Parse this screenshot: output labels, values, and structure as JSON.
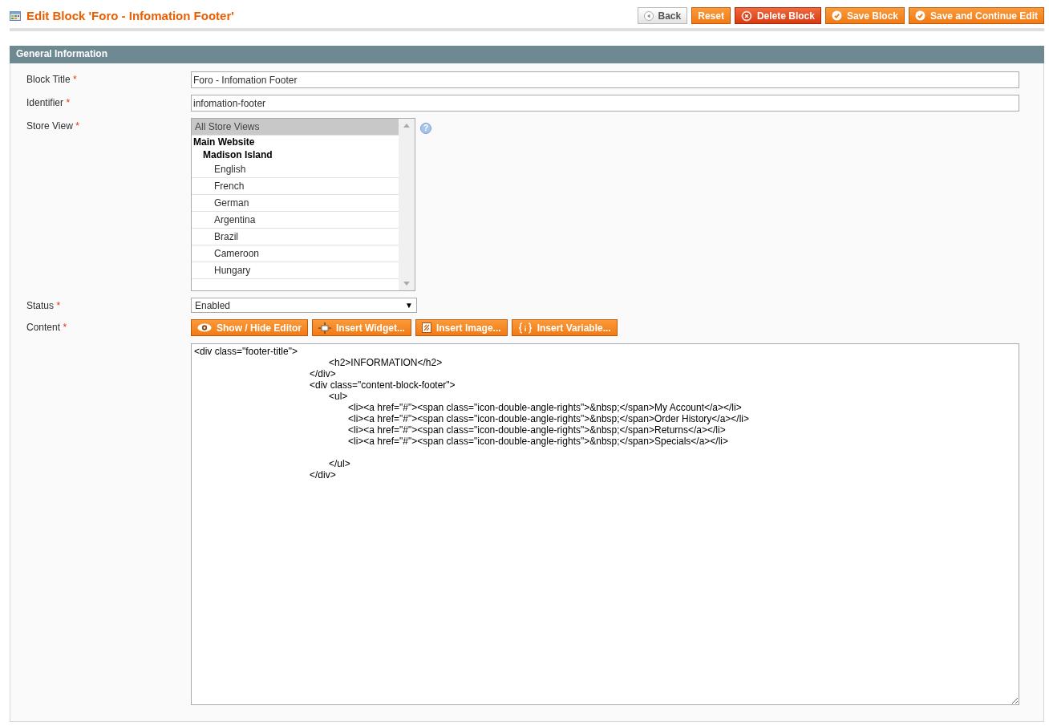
{
  "page": {
    "title": "Edit Block 'Foro - Infomation Footer'"
  },
  "actions": [
    {
      "label": "Back",
      "kind": "back"
    },
    {
      "label": "Reset",
      "kind": "plain"
    },
    {
      "label": "Delete Block",
      "kind": "delete"
    },
    {
      "label": "Save Block",
      "kind": "save"
    },
    {
      "label": "Save and Continue Edit",
      "kind": "save"
    }
  ],
  "section": {
    "title": "General Information"
  },
  "fields": [
    {
      "label": "Block Title",
      "required_mark": "*",
      "kind": "text",
      "value": "Foro - Infomation Footer"
    },
    {
      "label": "Identifier",
      "required_mark": "*",
      "kind": "text",
      "value": "infomation-footer"
    },
    {
      "label": "Store View",
      "required_mark": "*",
      "kind": "multiselect",
      "help": "?",
      "options": [
        {
          "label": "All Store Views",
          "selected": true
        },
        {
          "label": "Main Website",
          "kind": "group",
          "children": [
            {
              "label": "Madison Island",
              "kind": "group",
              "children": [
                {
                  "label": "English",
                  "selected": false
                },
                {
                  "label": "French",
                  "selected": false
                },
                {
                  "label": "German",
                  "selected": false
                },
                {
                  "label": "Argentina",
                  "selected": false
                },
                {
                  "label": "Brazil",
                  "selected": false
                },
                {
                  "label": "Cameroon",
                  "selected": false
                },
                {
                  "label": "Hungary",
                  "selected": false
                }
              ]
            }
          ]
        }
      ]
    },
    {
      "label": "Status",
      "required_mark": "*",
      "kind": "select",
      "value": "Enabled",
      "arrow": "▼"
    },
    {
      "label": "Content",
      "required_mark": "*",
      "kind": "editor",
      "buttons": [
        {
          "label": "Show / Hide Editor"
        },
        {
          "label": "Insert Widget..."
        },
        {
          "label": "Insert Image..."
        },
        {
          "label": "Insert Variable..."
        }
      ],
      "value": "<div class=\"footer-title\">\n\t\t\t\t\t\t\t<h2>INFORMATION</h2>\n\t\t\t\t\t\t</div>\n\t\t\t\t\t\t<div class=\"content-block-footer\">\n\t\t\t\t\t\t\t<ul>\n\t\t\t\t\t\t\t\t<li><a href=\"#\"><span class=\"icon-double-angle-rights\">&nbsp;</span>My Account</a></li>\n\t\t\t\t\t\t\t\t<li><a href=\"#\"><span class=\"icon-double-angle-rights\">&nbsp;</span>Order History</a></li>\n\t\t\t\t\t\t\t\t<li><a href=\"#\"><span class=\"icon-double-angle-rights\">&nbsp;</span>Returns</a></li>\n\t\t\t\t\t\t\t\t<li><a href=\"#\"><span class=\"icon-double-angle-rights\">&nbsp;</span>Specials</a></li>\n\n\t\t\t\t\t\t\t</ul>\n\t\t\t\t\t\t</div>"
    }
  ]
}
